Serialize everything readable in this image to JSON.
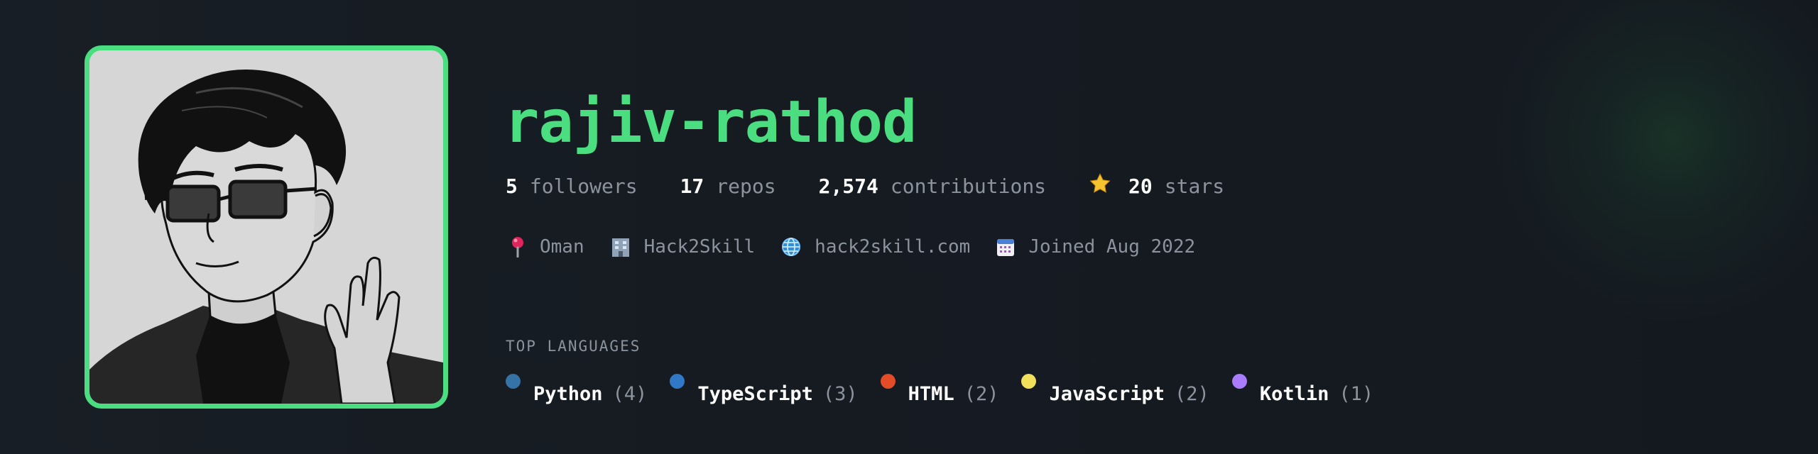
{
  "profile": {
    "username": "rajiv-rathod",
    "avatar": {
      "alt": "rajiv-rathod avatar",
      "border_color": "#4ade80"
    },
    "accent_color": "#4ade80"
  },
  "stats": [
    {
      "value": "5",
      "label": "followers"
    },
    {
      "value": "17",
      "label": "repos"
    },
    {
      "value": "2,574",
      "label": "contributions"
    },
    {
      "value": "20",
      "label": "stars",
      "icon": "star-icon"
    }
  ],
  "meta": {
    "location": {
      "icon": "pin-icon",
      "text": "Oman"
    },
    "company": {
      "icon": "building-icon",
      "text": "Hack2Skill"
    },
    "website": {
      "icon": "globe-icon",
      "text": "hack2skill.com"
    },
    "joined": {
      "icon": "calendar-icon",
      "text": "Joined Aug 2022"
    }
  },
  "languages": {
    "heading": "TOP LANGUAGES",
    "items": [
      {
        "name": "Python",
        "count": "(4)",
        "color": "#3572A5"
      },
      {
        "name": "TypeScript",
        "count": "(3)",
        "color": "#3178C6"
      },
      {
        "name": "HTML",
        "count": "(2)",
        "color": "#E34C26"
      },
      {
        "name": "JavaScript",
        "count": "(2)",
        "color": "#F1E05A"
      },
      {
        "name": "Kotlin",
        "count": "(1)",
        "color": "#A97BFF"
      }
    ]
  }
}
